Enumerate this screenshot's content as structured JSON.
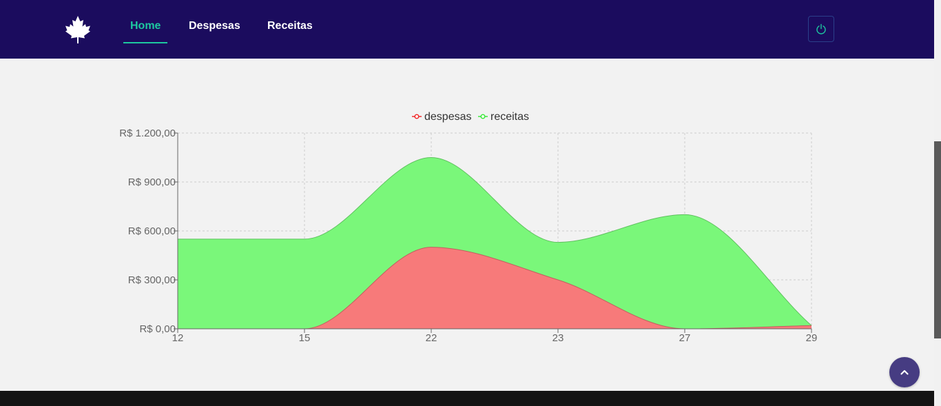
{
  "navbar": {
    "logo_icon": "maple-leaf-icon",
    "links": [
      {
        "label": "Home",
        "active": true
      },
      {
        "label": "Despesas",
        "active": false
      },
      {
        "label": "Receitas",
        "active": false
      }
    ],
    "power_icon": "power-icon",
    "background": "#1b0c5e",
    "active_color": "#1dc9a0"
  },
  "back_to_top_icon": "chevron-up-icon",
  "chart_data": {
    "type": "area",
    "categories": [
      "12",
      "15",
      "22",
      "23",
      "27",
      "29"
    ],
    "series": [
      {
        "name": "despesas",
        "values": [
          0,
          0,
          500,
          300,
          0,
          20
        ],
        "color": "#f77a7a"
      },
      {
        "name": "receitas",
        "values": [
          550,
          550,
          1050,
          530,
          700,
          20
        ],
        "color": "#7af77a"
      }
    ],
    "ylim": [
      0,
      1200
    ],
    "yticks": [
      "R$ 0,00",
      "R$ 300,00",
      "R$ 600,00",
      "R$ 900,00",
      "R$ 1.200,00"
    ],
    "grid": true,
    "legend": "top-center"
  }
}
